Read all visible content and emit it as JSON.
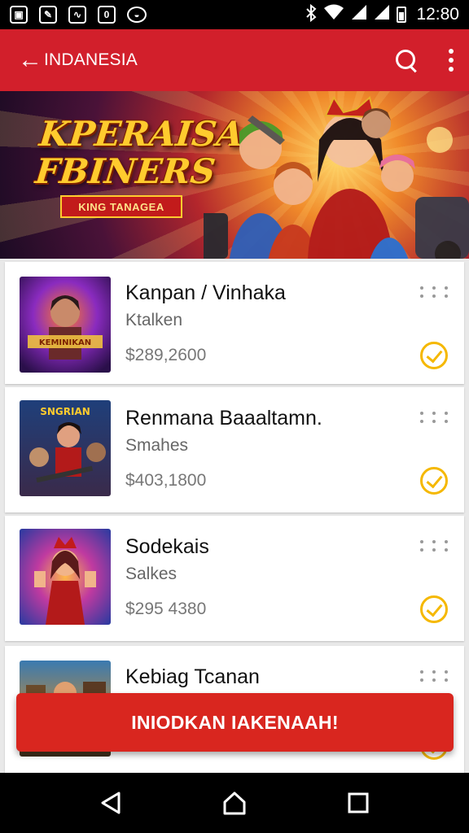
{
  "status_bar": {
    "left_icons": [
      "photo-icon",
      "edit-icon",
      "chart-icon",
      "b-icon",
      "shield-icon"
    ],
    "left_glyphs": [
      "▣",
      "✎",
      "∿",
      "0",
      "◒"
    ],
    "right_icons": [
      "bluetooth-icon",
      "wifi-icon",
      "signal-icon",
      "signal-icon",
      "battery-icon"
    ],
    "time": "12:80"
  },
  "app_bar": {
    "back_glyph": "←",
    "title": "INDANESIA",
    "background": "#d21f2b"
  },
  "banner": {
    "title": "KPERAISA FBINERS",
    "ribbon": "KING TANAGEA"
  },
  "items": [
    {
      "title": "Kanpan / Vinhaka",
      "subtitle": "Ktalken",
      "price": "$289,2600",
      "thumb_label": "KEMINIKAN"
    },
    {
      "title": "Renmana Baaaltamn.",
      "subtitle": "Smahes",
      "price": "$403,1800",
      "thumb_label": "SNGRIAN"
    },
    {
      "title": "Sodekais",
      "subtitle": "Salkes",
      "price": "$295 4380",
      "thumb_label": ""
    },
    {
      "title": "Kebiag Tcanan",
      "subtitle": "",
      "price": "",
      "thumb_label": ""
    }
  ],
  "cta": {
    "label": "INIODKAN IAKENAAH!",
    "background": "#d9261f"
  },
  "nav_bar": {
    "buttons": [
      "back-triangle-icon",
      "home-icon",
      "recents-icon"
    ]
  },
  "colors": {
    "accent": "#d21f2b",
    "check": "#f5b800"
  }
}
